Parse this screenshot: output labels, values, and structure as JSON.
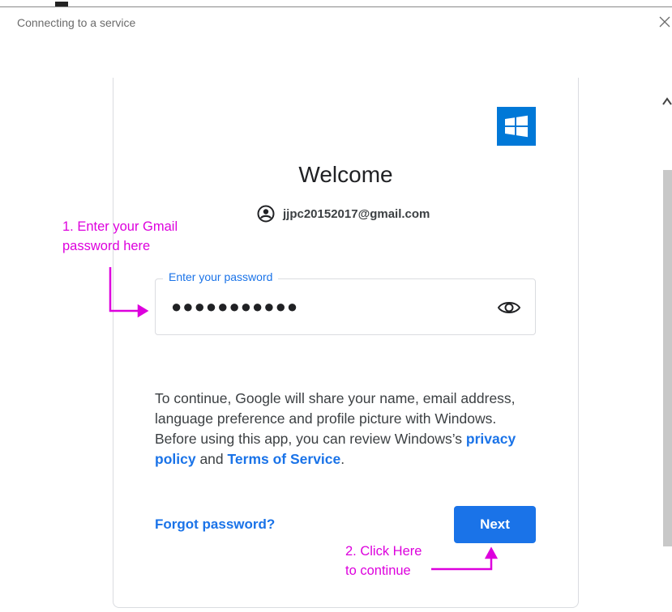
{
  "window": {
    "title": "Connecting to a service",
    "close_icon": "close-icon"
  },
  "card": {
    "logo": "windows-logo-icon",
    "heading": "Welcome",
    "account_icon": "account-circle-icon",
    "account_email": "jjpc20152017@gmail.com",
    "password_label": "Enter your password",
    "password_value": "●●●●●●●●●●●",
    "visibility_icon": "eye-icon",
    "consent_text_1": "To continue, Google will share your name, email address, language preference and profile picture with Windows. Before using this app, you can review Windows’s ",
    "privacy_link": "privacy policy",
    "consent_and": " and ",
    "terms_link": "Terms of Service",
    "consent_end": ".",
    "forgot_label": "Forgot password?",
    "next_label": "Next"
  },
  "annotations": {
    "step1_line1": "1. Enter your Gmail",
    "step1_line2": "password here",
    "step2_line1": "2. Click Here",
    "step2_line2": "to continue"
  },
  "colors": {
    "accent": "#1a73e8",
    "annotation": "#dd00dd",
    "windows_blue": "#0078d7"
  }
}
